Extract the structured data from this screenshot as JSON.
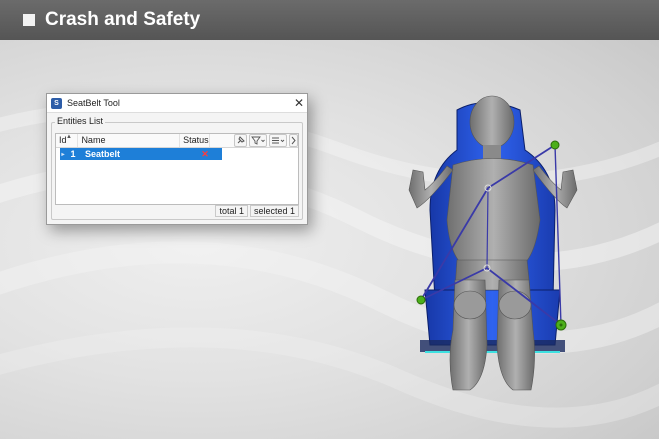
{
  "header": {
    "title": "Crash and Safety"
  },
  "dialog": {
    "title": "SeatBelt Tool",
    "close_glyph": "✕",
    "group_label": "Entities List",
    "columns": {
      "id": "Id",
      "name": "Name",
      "status": "Status"
    },
    "rows": [
      {
        "id": "1",
        "name": "Seatbelt",
        "status": "✕"
      }
    ],
    "status_total": "total 1",
    "status_selected": "selected 1"
  },
  "colors": {
    "header": "#5f5f5f",
    "selection": "#1e7fd8",
    "seat": "#1f4fd6",
    "belt": "#3a3aa8",
    "anchor": "#4caf1a"
  },
  "icons": [
    "seatbelt-tool-icon",
    "close-icon",
    "pin-icon",
    "filter-icon",
    "columns-icon",
    "scroll-right-icon"
  ]
}
